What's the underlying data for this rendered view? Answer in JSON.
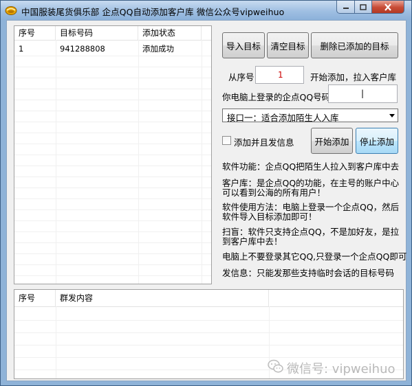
{
  "window": {
    "title": "中国服装尾货俱乐部 企点QQ自动添加客户库 微信公众号vipweihuo"
  },
  "target_list": {
    "columns": [
      "序号",
      "目标号码",
      "添加状态"
    ],
    "rows": [
      [
        "1",
        "941288808",
        "添加成功"
      ]
    ]
  },
  "buttons": {
    "import": "导入目标",
    "clear": "清空目标",
    "delete_added": "删除已添加的目标",
    "start": "开始添加",
    "stop": "停止添加"
  },
  "from_row": {
    "label_prefix": "从序号",
    "value": "1",
    "label_suffix": "开始添加，拉入客户库"
  },
  "qq_login": {
    "label": "你电脑上登录的企点QQ号码:",
    "value": "|"
  },
  "interface_select": {
    "selected": "接口一：适合添加陌生人入库"
  },
  "send_message": {
    "label": "添加并且发信息",
    "checked": false
  },
  "info_texts": [
    "软件功能：企点QQ把陌生人拉入到客户库中去",
    "客户库：是企点QQ的功能，在主号的账户中心\n可以看到公海的所有用户！",
    "软件使用方法：电脑上登录一个企点QQ，然后\n软件导入目标添加即可！",
    "扫盲：软件只支持企点QQ，不是加好友，是拉\n到客户库中去！",
    "电脑上不要登录其它QQ,只登录一个企点QQ即可",
    "发信息：只能发那些支持临时会话的目标号码"
  ],
  "message_list": {
    "columns": [
      "序号",
      "群发内容"
    ]
  },
  "watermark": {
    "text": "微信号: vipweihuo"
  },
  "colors": {
    "title_bar": "#9fbfe2",
    "close_button": "#c74b35",
    "number_value": "#cc0000"
  }
}
